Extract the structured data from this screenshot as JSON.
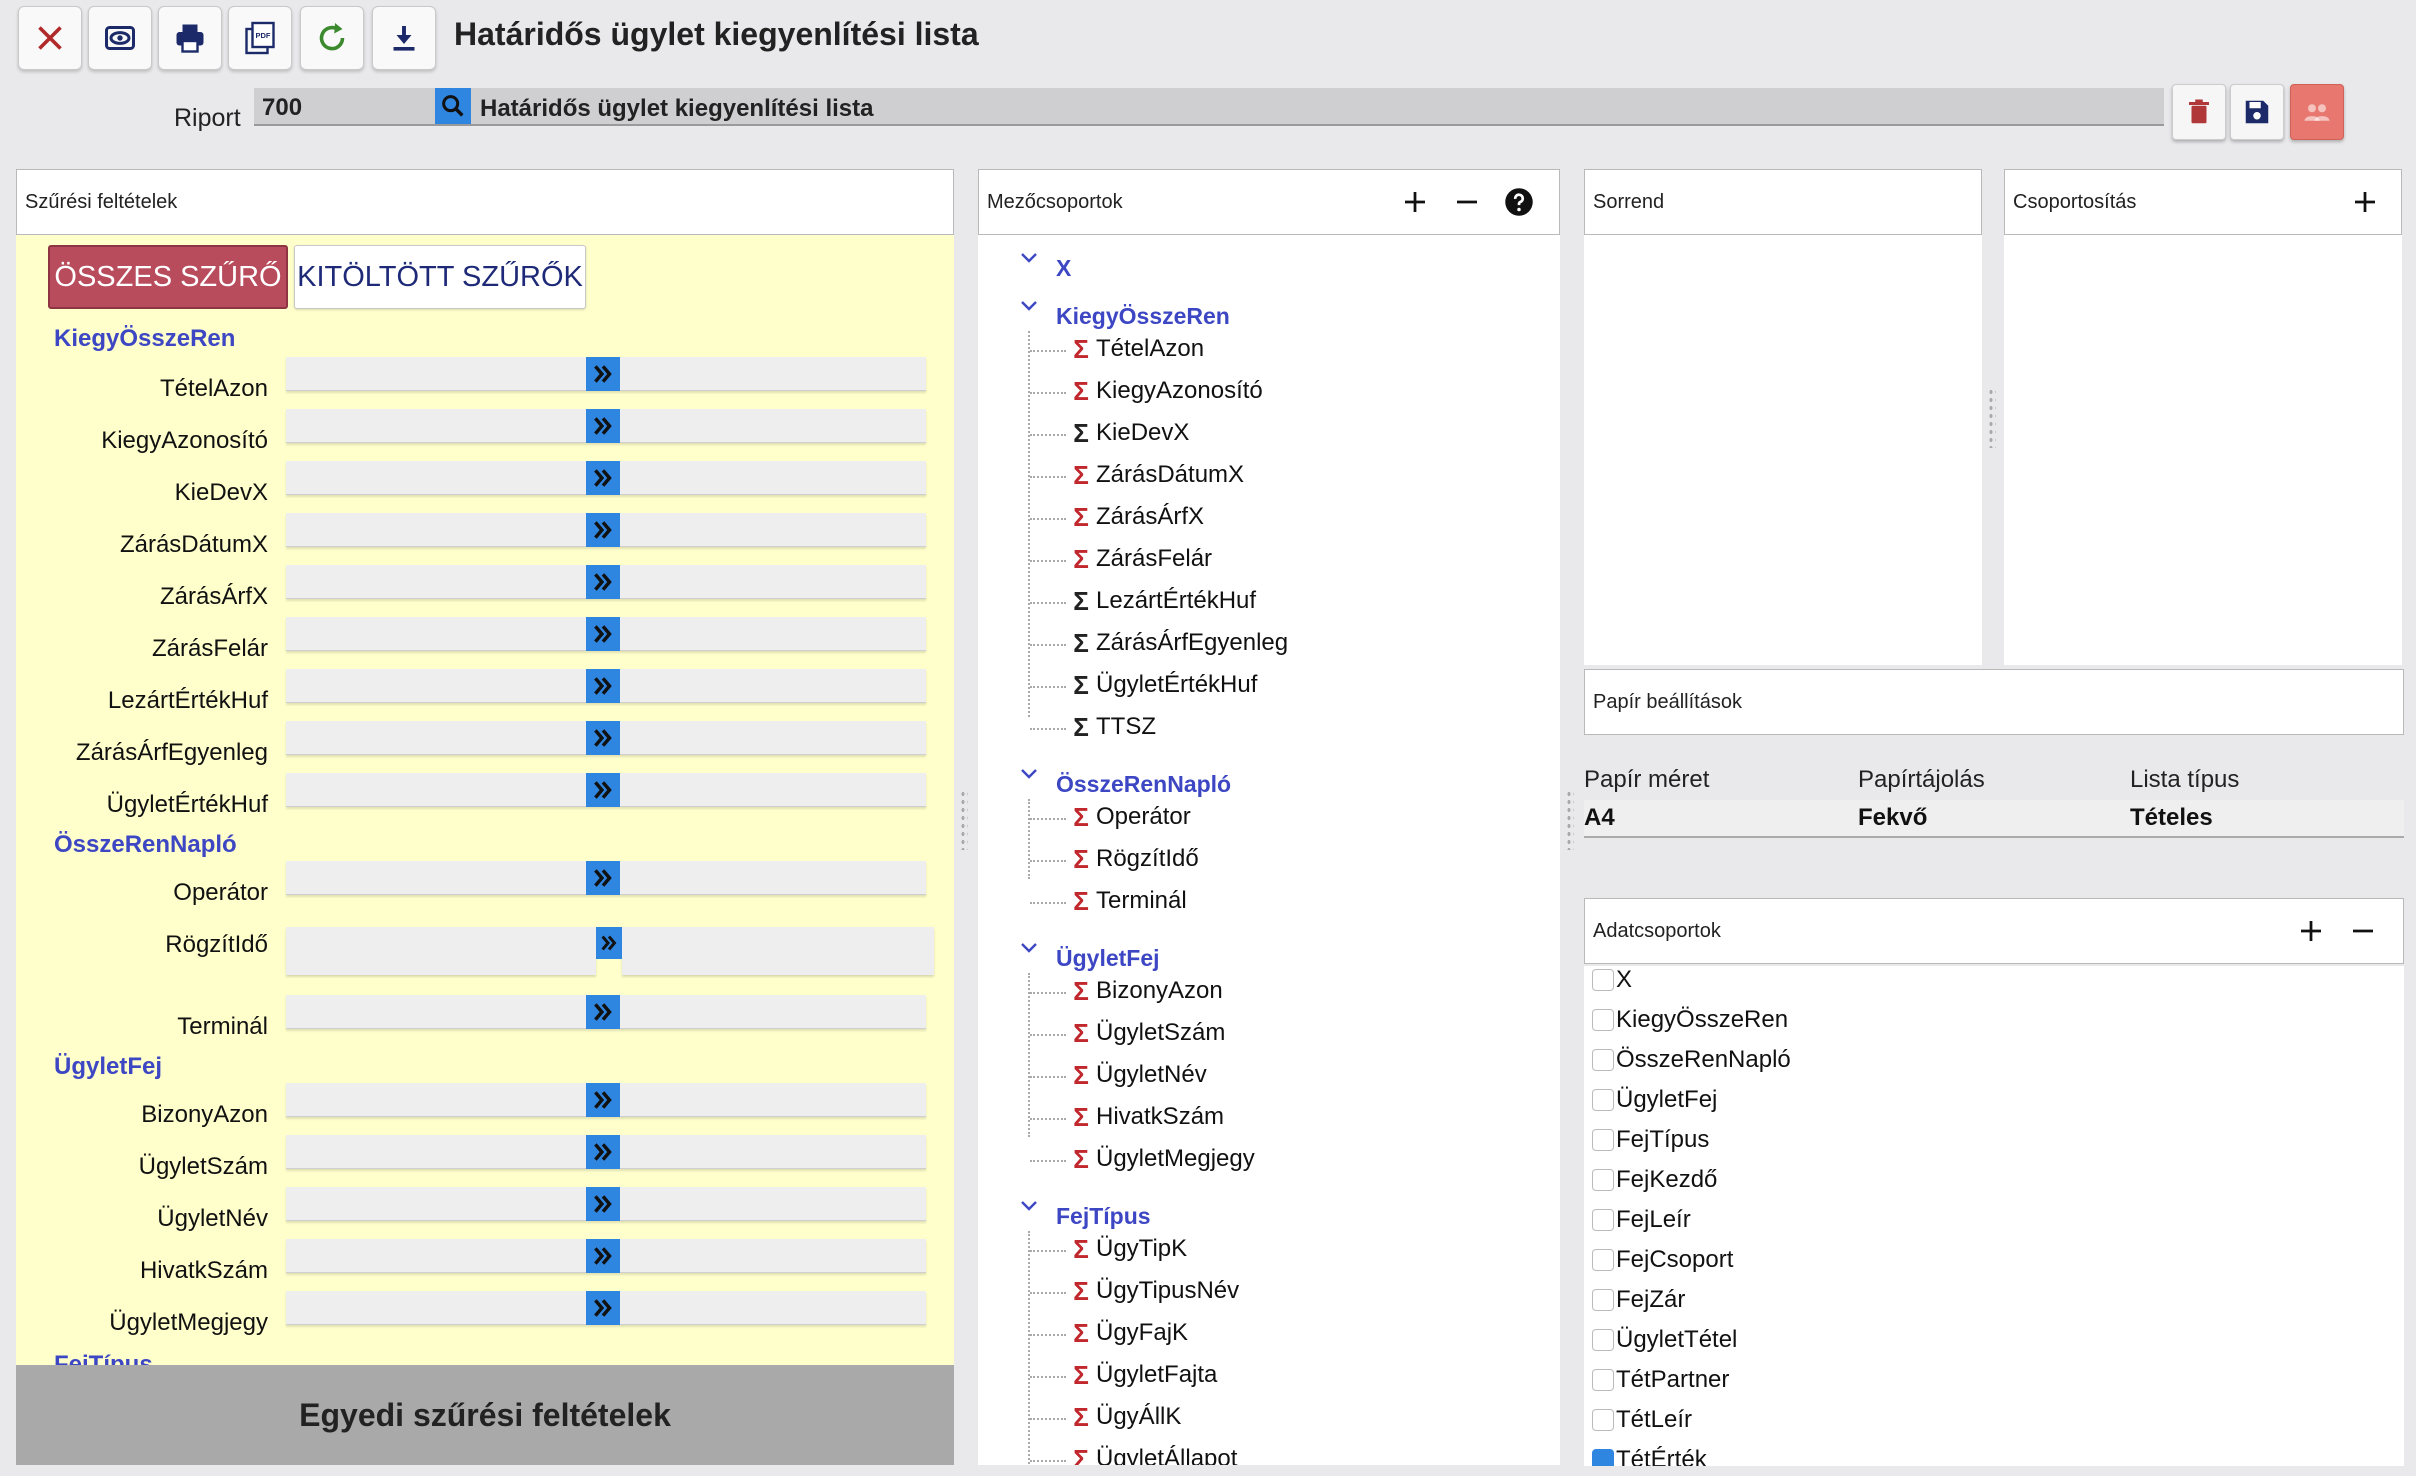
{
  "toolbar": {
    "title": "Határidős ügylet kiegyenlítési lista",
    "buttons": [
      "close-icon",
      "preview-icon",
      "print-icon",
      "pdf-icon",
      "refresh-icon",
      "download-icon"
    ],
    "pdf_glyph": "PDF"
  },
  "riport": {
    "label": "Riport",
    "code": "700",
    "name": "Határidős ügylet kiegyenlítési lista"
  },
  "filter": {
    "header": "Szűrési feltételek",
    "all_label": "ÖSSZES SZŰRŐ",
    "filled_label": "KITÖLTÖTT SZŰRŐK",
    "groups": [
      {
        "name": "KiegyÖsszeRen",
        "fields": [
          "TételAzon",
          "KiegyAzonosító",
          "KieDevX",
          "ZárásDátumX",
          "ZárásÁrfX",
          "ZárásFelár",
          "LezártÉrtékHuf",
          "ZárásÁrfEgyenleg",
          "ÜgyletÉrtékHuf"
        ]
      },
      {
        "name": "ÖsszeRenNapló",
        "fields": [
          "Operátor",
          "RögzítIdő",
          "Terminál"
        ]
      },
      {
        "name": "ÜgyletFej",
        "fields": [
          "BizonyAzon",
          "ÜgyletSzám",
          "ÜgyletNév",
          "HivatkSzám",
          "ÜgyletMegjegy"
        ]
      },
      {
        "name": "FejTípus",
        "fields": []
      }
    ],
    "footer": "Egyedi szűrési feltételek"
  },
  "fields": {
    "header": "Mezőcsoportok",
    "groups": [
      {
        "name": "X",
        "items": []
      },
      {
        "name": "KiegyÖsszeRen",
        "items": [
          {
            "label": "TételAzon",
            "sigma": "red"
          },
          {
            "label": "KiegyAzonosító",
            "sigma": "red"
          },
          {
            "label": "KieDevX",
            "sigma": "dark"
          },
          {
            "label": "ZárásDátumX",
            "sigma": "red"
          },
          {
            "label": "ZárásÁrfX",
            "sigma": "red"
          },
          {
            "label": "ZárásFelár",
            "sigma": "red"
          },
          {
            "label": "LezártÉrtékHuf",
            "sigma": "dark"
          },
          {
            "label": "ZárásÁrfEgyenleg",
            "sigma": "dark"
          },
          {
            "label": "ÜgyletÉrtékHuf",
            "sigma": "dark"
          },
          {
            "label": "TTSZ",
            "sigma": "dark"
          }
        ]
      },
      {
        "name": "ÖsszeRenNapló",
        "items": [
          {
            "label": "Operátor",
            "sigma": "red"
          },
          {
            "label": "RögzítIdő",
            "sigma": "red"
          },
          {
            "label": "Terminál",
            "sigma": "red"
          }
        ]
      },
      {
        "name": "ÜgyletFej",
        "items": [
          {
            "label": "BizonyAzon",
            "sigma": "red"
          },
          {
            "label": "ÜgyletSzám",
            "sigma": "red"
          },
          {
            "label": "ÜgyletNév",
            "sigma": "red"
          },
          {
            "label": "HivatkSzám",
            "sigma": "red"
          },
          {
            "label": "ÜgyletMegjegy",
            "sigma": "red"
          }
        ]
      },
      {
        "name": "FejTípus",
        "items": [
          {
            "label": "ÜgyTipK",
            "sigma": "red"
          },
          {
            "label": "ÜgyTipusNév",
            "sigma": "red"
          },
          {
            "label": "ÜgyFajK",
            "sigma": "red"
          },
          {
            "label": "ÜgyletFajta",
            "sigma": "red"
          },
          {
            "label": "ÜgyÁllK",
            "sigma": "red"
          },
          {
            "label": "ÜgyletÁllapot",
            "sigma": "red"
          }
        ]
      }
    ]
  },
  "sorrend": {
    "header": "Sorrend"
  },
  "csoportositas": {
    "header": "Csoportosítás"
  },
  "paper": {
    "header": "Papír beállítások",
    "columns": [
      {
        "label": "Papír méret",
        "value": "A4"
      },
      {
        "label": "Papírtájolás",
        "value": "Fekvő"
      },
      {
        "label": "Lista típus",
        "value": "Tételes"
      }
    ]
  },
  "adat": {
    "header": "Adatcsoportok",
    "items": [
      {
        "label": "X",
        "checked": false
      },
      {
        "label": "KiegyÖsszeRen",
        "checked": false
      },
      {
        "label": "ÖsszeRenNapló",
        "checked": false
      },
      {
        "label": "ÜgyletFej",
        "checked": false
      },
      {
        "label": "FejTípus",
        "checked": false
      },
      {
        "label": "FejKezdő",
        "checked": false
      },
      {
        "label": "FejLeír",
        "checked": false
      },
      {
        "label": "FejCsoport",
        "checked": false
      },
      {
        "label": "FejZár",
        "checked": false
      },
      {
        "label": "ÜgyletTétel",
        "checked": false
      },
      {
        "label": "TétPartner",
        "checked": false
      },
      {
        "label": "TétLeír",
        "checked": false
      },
      {
        "label": "TétÉrték",
        "checked": true
      }
    ]
  },
  "colors": {
    "accent": "#2f86e0",
    "group_label": "#3d47c4",
    "danger": "#b84c5c",
    "filter_bg": "#ffffcc",
    "sigma_red": "#c0282d"
  }
}
